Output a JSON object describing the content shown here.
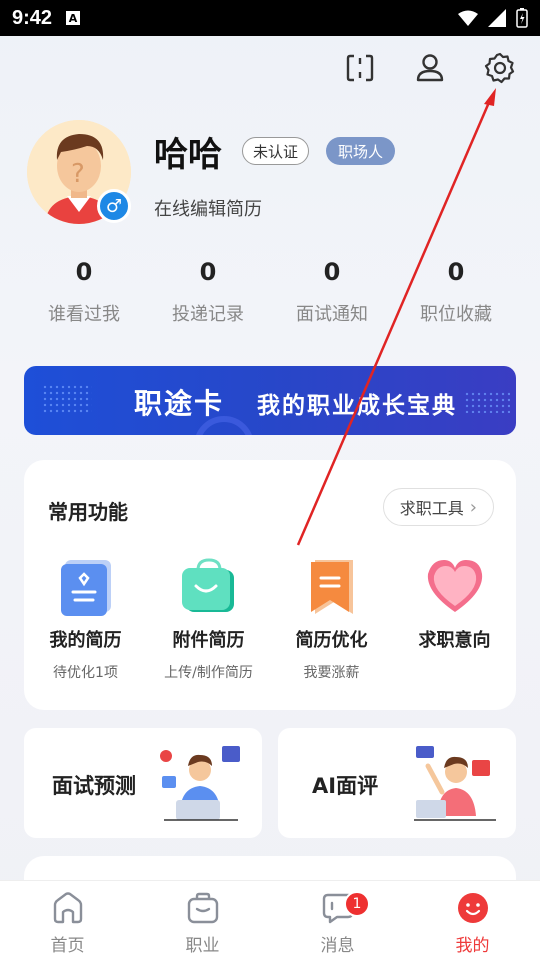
{
  "status_bar": {
    "time": "9:42",
    "notif_icon": "A"
  },
  "top_icons": [
    "scan-icon",
    "person-icon",
    "settings-icon"
  ],
  "profile": {
    "name": "哈哈",
    "badge_unverified": "未认证",
    "badge_role": "职场人",
    "edit_link": "在线编辑简历",
    "gender_symbol": "♂"
  },
  "stats": [
    {
      "value": "0",
      "label": "谁看过我"
    },
    {
      "value": "0",
      "label": "投递记录"
    },
    {
      "value": "0",
      "label": "面试通知"
    },
    {
      "value": "0",
      "label": "职位收藏"
    }
  ],
  "banner": {
    "title": "职途卡",
    "subtitle": "我的职业成长宝典"
  },
  "common_functions": {
    "title": "常用功能",
    "tools_button": "求职工具",
    "items": [
      {
        "name": "我的简历",
        "sub": "待优化1项",
        "icon": "resume-icon"
      },
      {
        "name": "附件简历",
        "sub": "上传/制作简历",
        "icon": "attachment-bag-icon"
      },
      {
        "name": "简历优化",
        "sub": "我要涨薪",
        "icon": "bookmark-icon"
      },
      {
        "name": "求职意向",
        "sub": "",
        "icon": "heart-icon"
      }
    ]
  },
  "cards": [
    {
      "label": "面试预测"
    },
    {
      "label": "AI面评"
    }
  ],
  "tabbar": {
    "tabs": [
      {
        "label": "首页"
      },
      {
        "label": "职业"
      },
      {
        "label": "消息",
        "badge": "1"
      },
      {
        "label": "我的"
      }
    ]
  },
  "colors": {
    "accent_red": "#ee3a3a",
    "banner_blue": "#2747c9",
    "badge_blue": "#7b96c8"
  }
}
